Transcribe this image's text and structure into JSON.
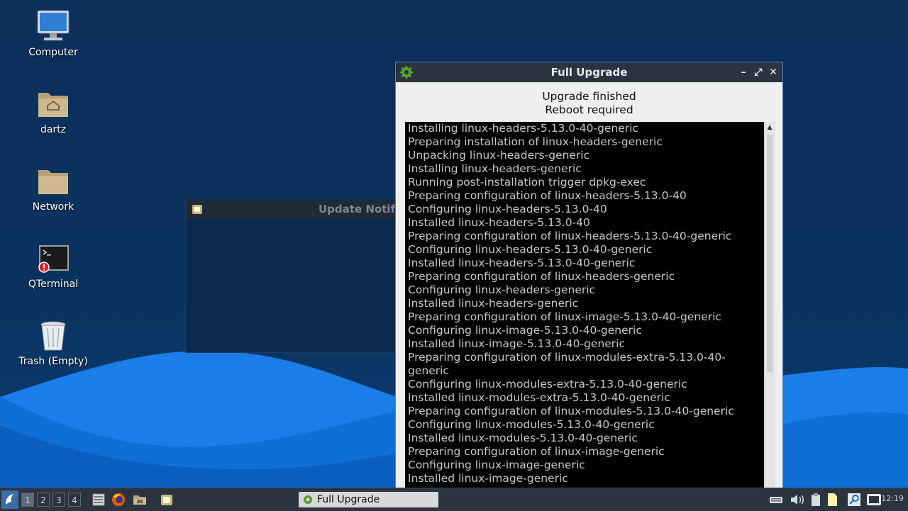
{
  "desktop": {
    "icons": [
      {
        "label": "Computer",
        "icon": "computer-icon"
      },
      {
        "label": "dartz",
        "icon": "home-folder-icon"
      },
      {
        "label": "Network",
        "icon": "folder-icon"
      },
      {
        "label": "QTerminal",
        "icon": "terminal-icon"
      },
      {
        "label": "Trash (Empty)",
        "icon": "trash-icon"
      }
    ]
  },
  "background_window": {
    "title": "Update Notifi"
  },
  "window": {
    "title": "Full Upgrade",
    "status_line1": "Upgrade finished",
    "status_line2": "Reboot required",
    "controls": {
      "minimize": "–",
      "maximize": "⤢",
      "close": "✕"
    },
    "log": [
      "Installing linux-headers-5.13.0-40-generic",
      "Preparing installation of linux-headers-generic",
      "Unpacking linux-headers-generic",
      "Installing linux-headers-generic",
      "Running post-installation trigger dpkg-exec",
      "Preparing configuration of linux-headers-5.13.0-40",
      "Configuring linux-headers-5.13.0-40",
      "Installed linux-headers-5.13.0-40",
      "Preparing configuration of linux-headers-5.13.0-40-generic",
      "Configuring linux-headers-5.13.0-40-generic",
      "Installed linux-headers-5.13.0-40-generic",
      "Preparing configuration of linux-headers-generic",
      "Configuring linux-headers-generic",
      "Installed linux-headers-generic",
      "Preparing configuration of linux-image-5.13.0-40-generic",
      "Configuring linux-image-5.13.0-40-generic",
      "Installed linux-image-5.13.0-40-generic",
      "Preparing configuration of linux-modules-extra-5.13.0-40-generic",
      "Configuring linux-modules-extra-5.13.0-40-generic",
      "Installed linux-modules-extra-5.13.0-40-generic",
      "Preparing configuration of linux-modules-5.13.0-40-generic",
      "Configuring linux-modules-5.13.0-40-generic",
      "Installed linux-modules-5.13.0-40-generic",
      "Preparing configuration of linux-image-generic",
      "Configuring linux-image-generic",
      "Installed linux-image-generic"
    ]
  },
  "taskbar": {
    "desktops": [
      "1",
      "2",
      "3",
      "4"
    ],
    "active_desktop": "1",
    "task_label": "Full Upgrade",
    "clock": "12:19"
  },
  "colors": {
    "desktop_bg": "#0d2f5a",
    "wave_light": "#1e88f0",
    "window_border": "#4a87c9",
    "titlebar": "#2a3441",
    "taskbar": "#2b3441"
  }
}
